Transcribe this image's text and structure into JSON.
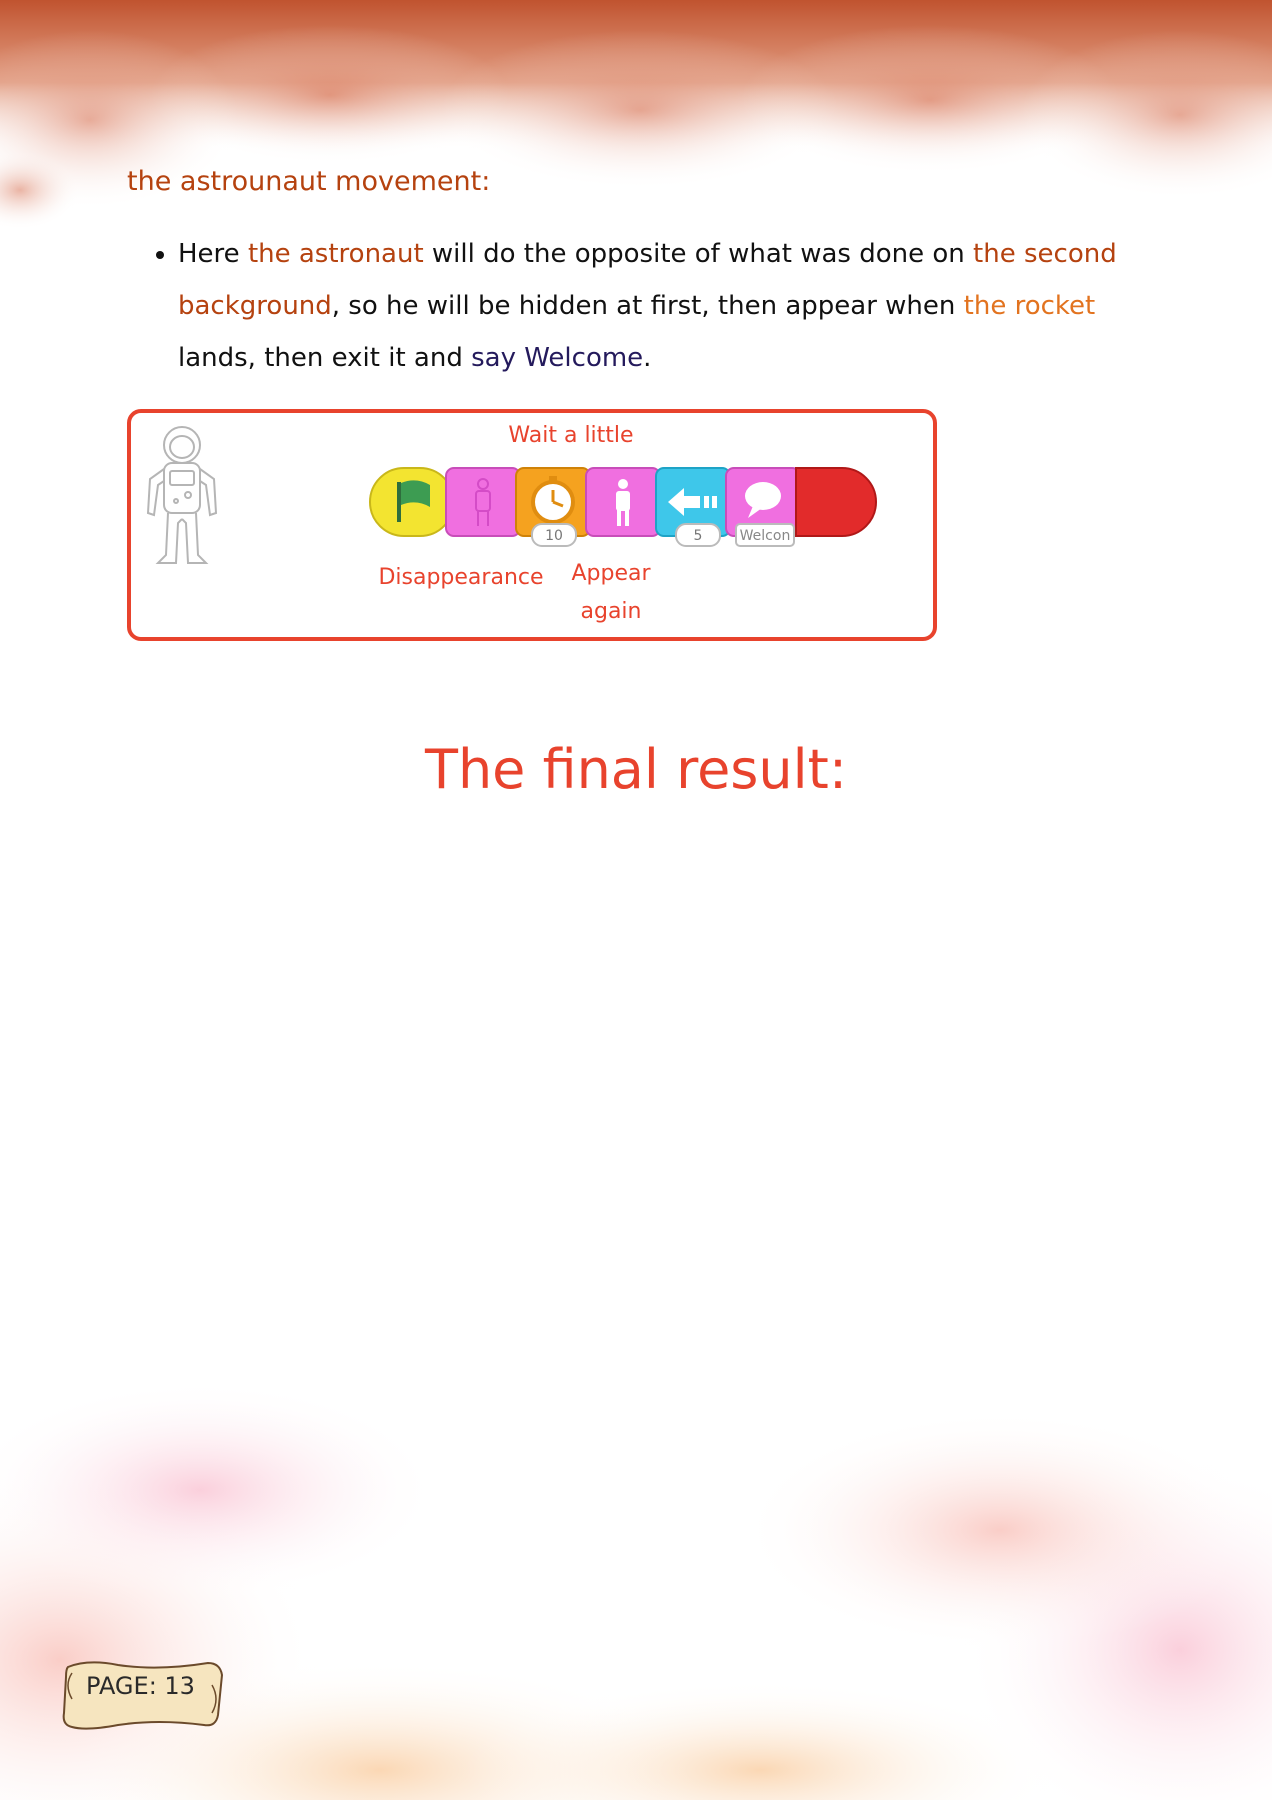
{
  "section": {
    "heading": "the astrounaut movement:"
  },
  "bullet": {
    "t1": "Here ",
    "h1": "the astronaut",
    "t2": " will do the opposite of what was done on ",
    "h2": "the second background",
    "t3": ", so he will be hidden at first, then appear when ",
    "h3": "the rocket",
    "t4": " lands, then exit it and ",
    "h4": "say Welcome",
    "t5": "."
  },
  "code": {
    "wait_label": "Wait a little",
    "disappear_label": "Disappearance",
    "appear_label_1": "Appear",
    "appear_label_2": "again",
    "wait_value": "10",
    "move_value": "5",
    "say_value": "Welcon"
  },
  "final": {
    "title": "The final result:"
  },
  "footer": {
    "page_label": "PAGE: 13"
  },
  "colors": {
    "accent_red": "#e8432d",
    "heading_brown": "#b5420f",
    "highlight_orange": "#e2731f",
    "navy": "#241a5c"
  },
  "icons": [
    "astronaut-icon",
    "green-flag-icon",
    "hide-icon",
    "stopwatch-icon",
    "show-icon",
    "move-left-icon",
    "speech-bubble-icon",
    "end-block-icon"
  ]
}
